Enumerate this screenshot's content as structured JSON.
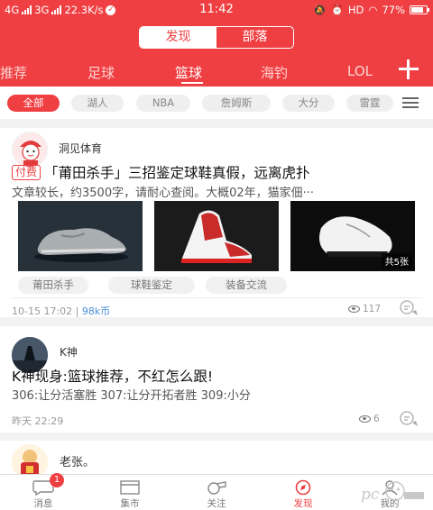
{
  "status_bar": {
    "net1": "4G",
    "net2": "3G",
    "speed": "22.3K/s",
    "time": "11:42",
    "hd": "HD",
    "battery": "77%"
  },
  "segment": {
    "left": "发现",
    "right": "部落",
    "selected": "发现"
  },
  "channels": {
    "items": [
      "推荐",
      "足球",
      "篮球",
      "海钓",
      "LOL"
    ],
    "active": "篮球"
  },
  "filters": {
    "items": [
      "全部",
      "湖人",
      "NBA",
      "詹姆斯",
      "大分",
      "雷霆"
    ],
    "active": "全部"
  },
  "posts": [
    {
      "author": "洞见体育",
      "badge": "付费",
      "title": "「莆田杀手」三招鉴定球鞋真假，远离虎扑",
      "desc": "文章较长，约3500字，请耐心查阅。大概02年，猫家佃···",
      "image_count": "共5张",
      "tags": [
        "莆田杀手",
        "球鞋鉴定",
        "装备交流"
      ],
      "time": "10-15 17:02",
      "separator": " | ",
      "price": "98k币",
      "views": "117"
    },
    {
      "author": "K神",
      "title": "K神现身:篮球推荐，不红怎么跟!",
      "desc": "306:让分活塞胜 307:让分开拓者胜 309:小分",
      "time": "昨天 22:29",
      "views": "6"
    },
    {
      "author": "老张。"
    }
  ],
  "tabbar": {
    "items": [
      "消息",
      "集市",
      "关注",
      "发现",
      "我的"
    ],
    "active": "发现",
    "message_badge": "1"
  },
  "colors": {
    "accent": "#ef3f42",
    "link": "#4a8fd8"
  }
}
